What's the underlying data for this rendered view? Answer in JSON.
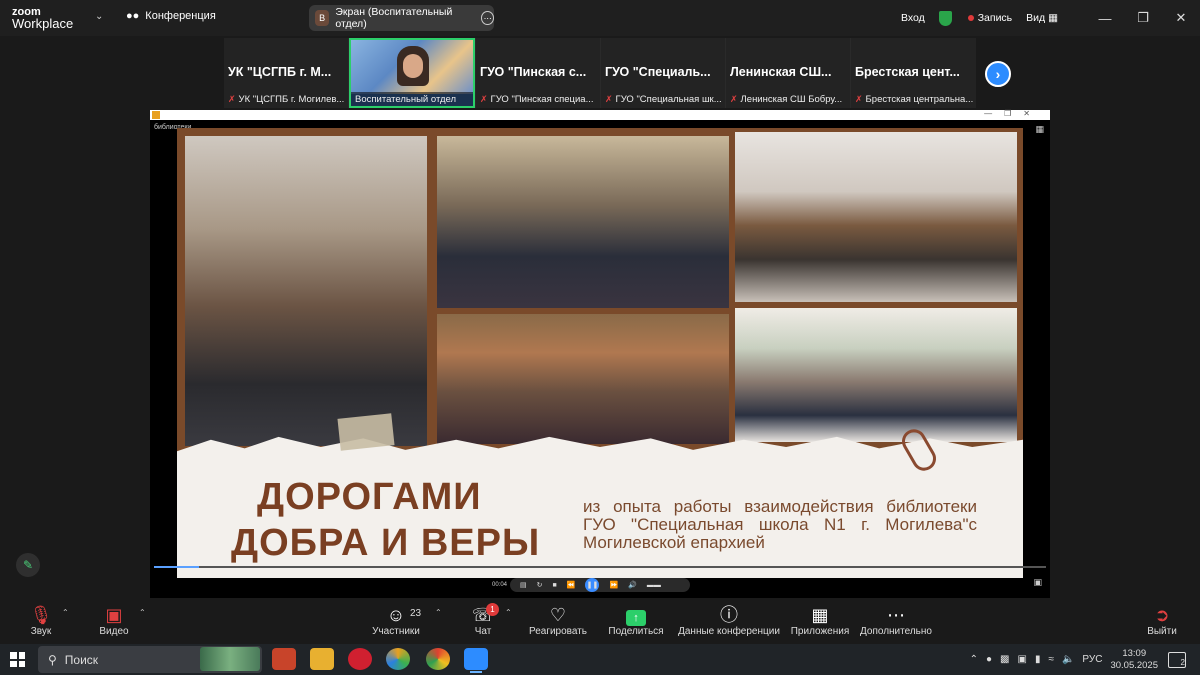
{
  "app": {
    "logo_line1": "zoom",
    "logo_line2": "Workplace"
  },
  "header": {
    "conference_label": "Конференция",
    "screen_share_avatar": "В",
    "screen_share_label": "Экран (Воспитательный отдел)",
    "signin_label": "Вход",
    "record_label": "Запись",
    "view_label": "Вид"
  },
  "gallery": {
    "tiles": [
      {
        "big": "УК \"ЦСГПБ г. М...",
        "small": "УК \"ЦСГПБ г. Могилев..."
      },
      {
        "big": "",
        "small": "Воспитательный отдел"
      },
      {
        "big": "ГУО \"Пинская с...",
        "small": "ГУО \"Пинская специа..."
      },
      {
        "big": "ГУО \"Специаль...",
        "small": "ГУО \"Специальная шк..."
      },
      {
        "big": "Ленинская СШ...",
        "small": "Ленинская СШ Бобру..."
      },
      {
        "big": "Брестская цент...",
        "small": "Брестская центральна..."
      }
    ]
  },
  "shared_window": {
    "tab_label": "библиотеки",
    "slide": {
      "title_line1": "ДОРОГАМИ",
      "title_line2": "ДОБРА И ВЕРЫ",
      "description": "из опыта работы взаимодействия библиотеки ГУО \"Специальная школа N1 г. Могилева\"с Могилевской епархией"
    },
    "player": {
      "time": "00:04",
      "progress": 0.05
    }
  },
  "toolbar": {
    "audio": "Звук",
    "video": "Видео",
    "participants": "Участники",
    "participants_count": "23",
    "chat": "Чат",
    "chat_badge": "1",
    "react": "Реагировать",
    "share": "Поделиться",
    "info": "Данные конференции",
    "apps": "Приложения",
    "more": "Дополнительно",
    "leave": "Выйти"
  },
  "taskbar": {
    "search_placeholder": "Поиск",
    "lang": "РУС",
    "time": "13:09",
    "date": "30.05.2025",
    "notifications": "2"
  },
  "colors": {
    "accent_green": "#2ccf6a",
    "accent_blue": "#2d8cff",
    "slide_brown": "#7a3f22"
  }
}
